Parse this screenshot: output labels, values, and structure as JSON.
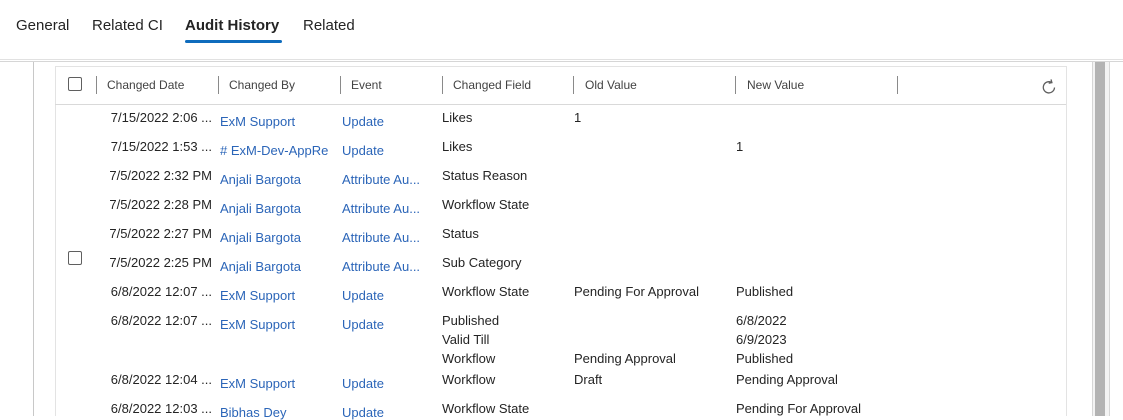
{
  "tabs": [
    {
      "label": "General"
    },
    {
      "label": "Related CI"
    },
    {
      "label": "Audit History",
      "active": true
    },
    {
      "label": "Related"
    }
  ],
  "accent_color": "#0f6cbd",
  "link_color": "#2b65b8",
  "grid": {
    "columns": [
      "Changed Date",
      "Changed By",
      "Event",
      "Changed Field",
      "Old Value",
      "New Value"
    ],
    "refresh_icon": "refresh-icon",
    "rows": [
      {
        "date": "7/15/2022 2:06 ...",
        "by": "ExM Support",
        "event": "Update",
        "field": "Likes",
        "old": "1",
        "new": ""
      },
      {
        "date": "7/15/2022 1:53 ...",
        "by": "# ExM-Dev-AppRe",
        "event": "Update",
        "field": "Likes",
        "old": "",
        "new": "1"
      },
      {
        "date": "7/5/2022 2:32 PM",
        "by": "Anjali Bargota",
        "event": "Attribute Au...",
        "field": "Status Reason",
        "old": "",
        "new": ""
      },
      {
        "date": "7/5/2022 2:28 PM",
        "by": "Anjali Bargota",
        "event": "Attribute Au...",
        "field": "Workflow State",
        "old": "",
        "new": ""
      },
      {
        "date": "7/5/2022 2:27 PM",
        "by": "Anjali Bargota",
        "event": "Attribute Au...",
        "field": "Status",
        "old": "",
        "new": ""
      },
      {
        "date": "7/5/2022 2:25 PM",
        "by": "Anjali Bargota",
        "event": "Attribute Au...",
        "field": "Sub Category",
        "old": "",
        "new": ""
      },
      {
        "date": "6/8/2022 12:07 ...",
        "by": "ExM Support",
        "event": "Update",
        "field": "Workflow State",
        "old": "Pending For Approval",
        "new": "Published"
      },
      {
        "date": "6/8/2022 12:07 ...",
        "by": "ExM Support",
        "event": "Update",
        "fields": [
          "Published",
          "Valid Till",
          "Workflow"
        ],
        "olds": [
          "",
          "",
          "Pending Approval"
        ],
        "news": [
          "6/8/2022",
          "6/9/2023",
          "Published"
        ]
      },
      {
        "date": "6/8/2022 12:04 ...",
        "by": "ExM Support",
        "event": "Update",
        "field": "Workflow",
        "old": "Draft",
        "new": "Pending Approval"
      },
      {
        "date": "6/8/2022 12:03 ...",
        "by": "Bibhas Dey",
        "event": "Update",
        "field": "Workflow State",
        "old": "",
        "new": "Pending For Approval"
      }
    ]
  }
}
